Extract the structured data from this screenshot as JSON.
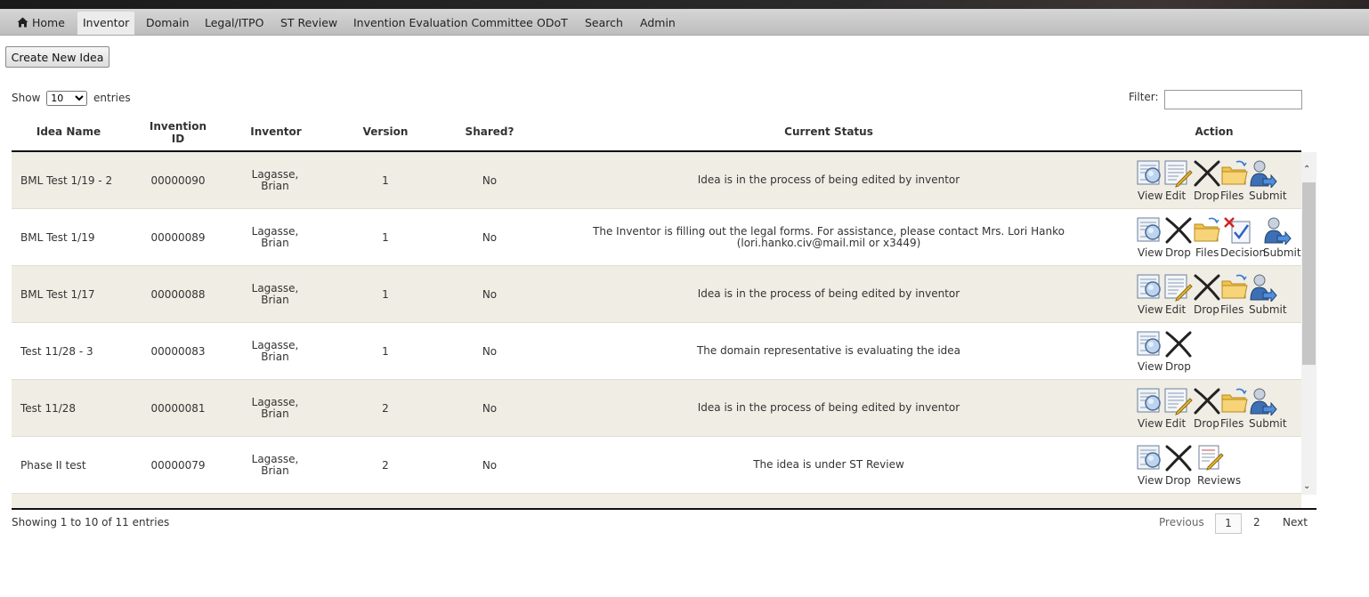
{
  "nav": {
    "items": [
      {
        "label": "Home"
      },
      {
        "label": "Inventor"
      },
      {
        "label": "Domain"
      },
      {
        "label": "Legal/ITPO"
      },
      {
        "label": "ST Review"
      },
      {
        "label": "Invention Evaluation Committee"
      },
      {
        "label": "ODoT"
      },
      {
        "label": "Search"
      },
      {
        "label": "Admin"
      }
    ],
    "active": "Inventor"
  },
  "toolbar": {
    "create_label": "Create New Idea"
  },
  "length_menu": {
    "show_label": "Show",
    "selected": "10",
    "entries_label": "entries"
  },
  "filter": {
    "label": "Filter:",
    "value": ""
  },
  "table": {
    "headers": {
      "idea_name": "Idea Name",
      "invention_id_1": "Invention",
      "invention_id_2": "ID",
      "inventor": "Inventor",
      "version": "Version",
      "shared": "Shared?",
      "status": "Current Status",
      "action": "Action"
    },
    "rows": [
      {
        "name": "BML Test 1/19 - 2",
        "id": "00000090",
        "inventor_1": "Lagasse,",
        "inventor_2": "Brian",
        "version": "1",
        "shared": "No",
        "status": "Idea is in the process of being edited by inventor",
        "actions": [
          "View",
          "Edit",
          "Drop",
          "Files",
          "Submit"
        ]
      },
      {
        "name": "BML Test 1/19",
        "id": "00000089",
        "inventor_1": "Lagasse,",
        "inventor_2": "Brian",
        "version": "1",
        "shared": "No",
        "status": "The Inventor is filling out the legal forms. For assistance, please contact Mrs. Lori Hanko (lori.hanko.civ@mail.mil or x3449)",
        "actions": [
          "View",
          "Drop",
          "Files",
          "Decision",
          "Submit"
        ]
      },
      {
        "name": "BML Test 1/17",
        "id": "00000088",
        "inventor_1": "Lagasse,",
        "inventor_2": "Brian",
        "version": "1",
        "shared": "No",
        "status": "Idea is in the process of being edited by inventor",
        "actions": [
          "View",
          "Edit",
          "Drop",
          "Files",
          "Submit"
        ]
      },
      {
        "name": "Test 11/28 - 3",
        "id": "00000083",
        "inventor_1": "Lagasse,",
        "inventor_2": "Brian",
        "version": "1",
        "shared": "No",
        "status": "The domain representative is evaluating the idea",
        "actions": [
          "View",
          "Drop"
        ]
      },
      {
        "name": "Test 11/28",
        "id": "00000081",
        "inventor_1": "Lagasse,",
        "inventor_2": "Brian",
        "version": "2",
        "shared": "No",
        "status": "Idea is in the process of being edited by inventor",
        "actions": [
          "View",
          "Edit",
          "Drop",
          "Files",
          "Submit"
        ]
      },
      {
        "name": "Phase II test",
        "id": "00000079",
        "inventor_1": "Lagasse,",
        "inventor_2": "Brian",
        "version": "2",
        "shared": "No",
        "status": "The idea is under ST Review",
        "actions": [
          "View",
          "Drop",
          "Reviews"
        ]
      }
    ]
  },
  "footer": {
    "info": "Showing 1 to 10 of 11 entries",
    "previous": "Previous",
    "pages": [
      "1",
      "2"
    ],
    "current_page": "1",
    "next": "Next"
  },
  "icons": {
    "view": "view-document-icon",
    "edit": "edit-pencil-icon",
    "drop": "drop-x-icon",
    "files": "folder-icon",
    "submit": "submit-user-icon",
    "decision": "decision-icon",
    "reviews": "reviews-icon"
  }
}
